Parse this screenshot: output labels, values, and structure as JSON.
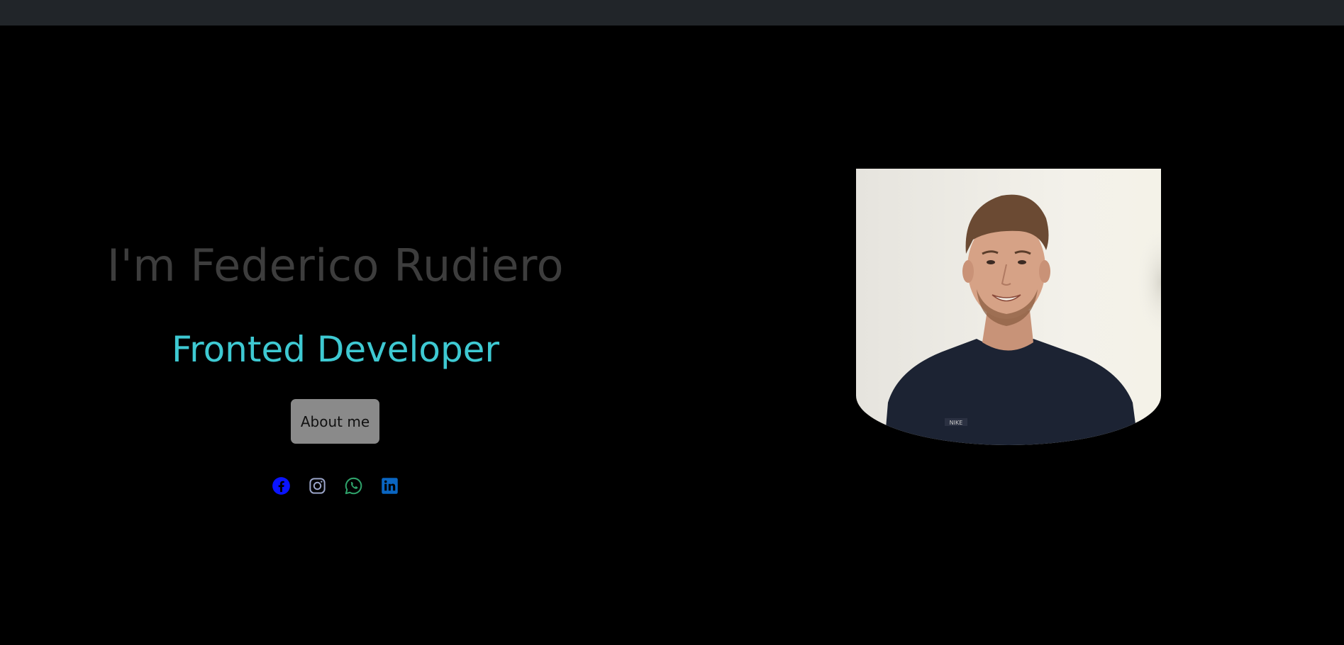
{
  "hero": {
    "title": "I'm Federico Rudiero",
    "subtitle": "Fronted Developer",
    "about_button": "About me"
  },
  "socials": [
    {
      "name": "facebook-icon",
      "color": "#0a14ff"
    },
    {
      "name": "instagram-icon",
      "color": "#9aa4c8"
    },
    {
      "name": "whatsapp-icon",
      "color": "#2fa36b"
    },
    {
      "name": "linkedin-icon",
      "color": "#0a66c2"
    }
  ],
  "colors": {
    "navbar": "#212529",
    "background": "#000000",
    "title": "#3d3d3d",
    "subtitle": "#3ec9d2",
    "button_bg": "#8a8a8a"
  },
  "photo": {
    "shirt_text": "NIKE"
  }
}
